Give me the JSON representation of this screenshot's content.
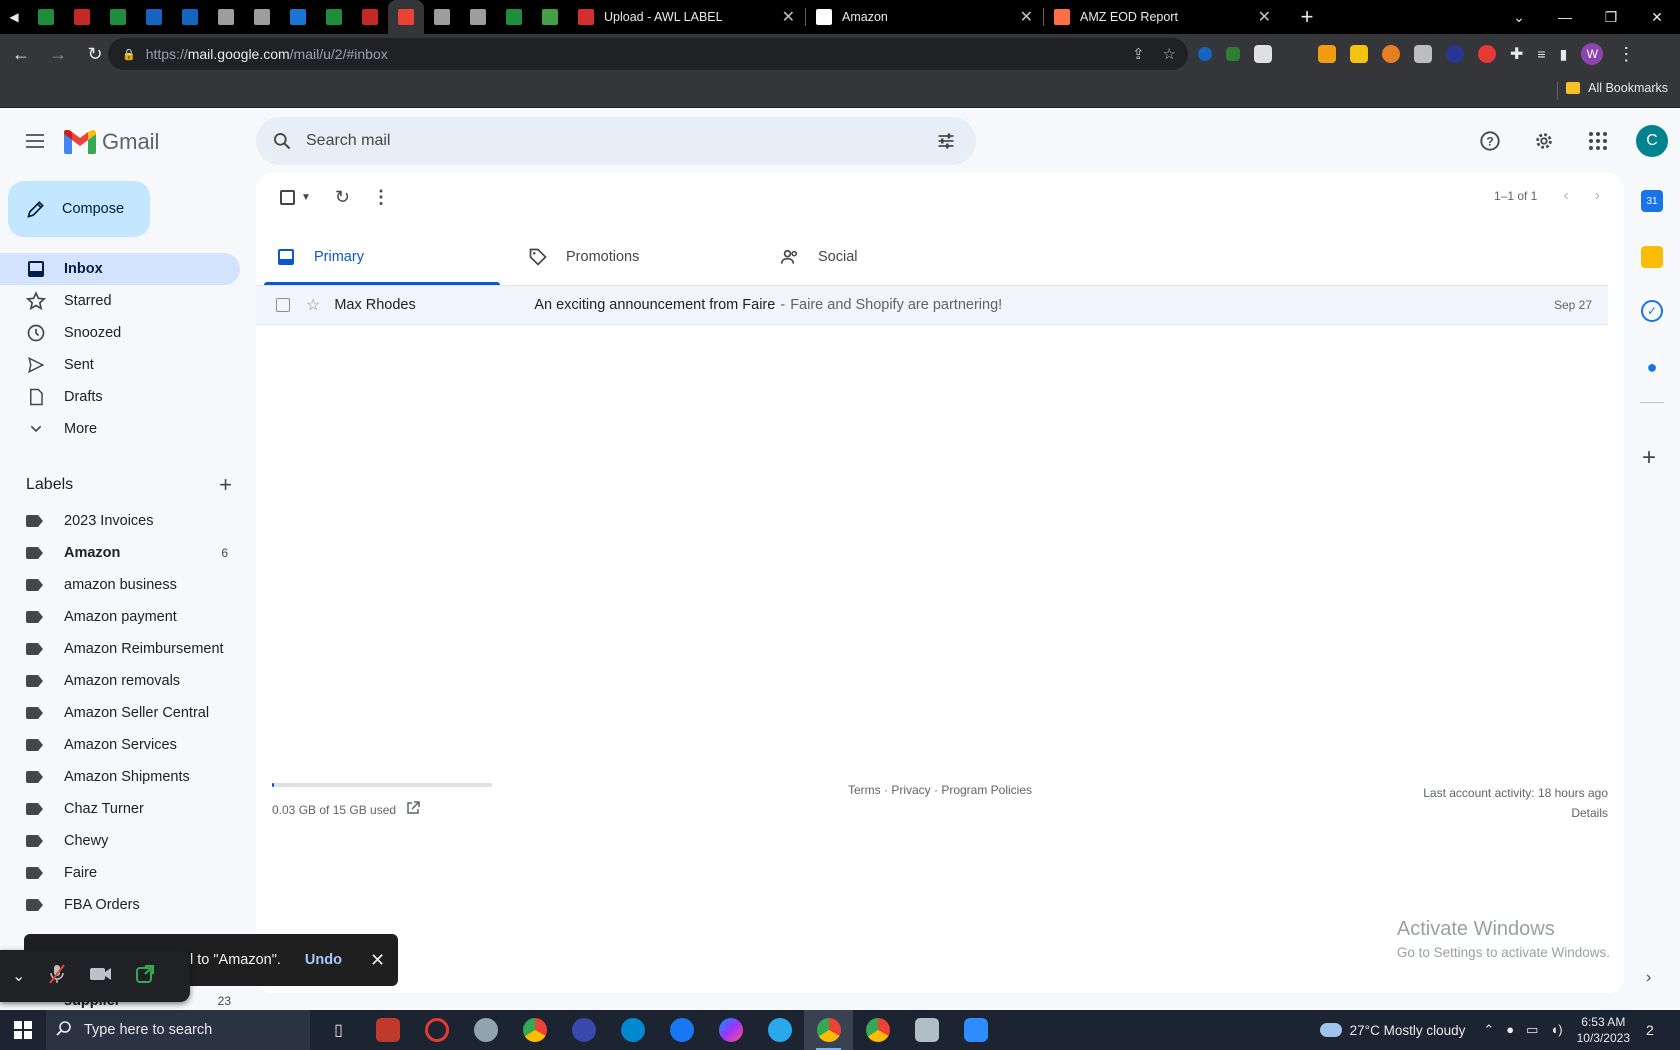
{
  "browser": {
    "pinned_tabs": [
      {
        "icon": "sheets-icon",
        "color": "#1e8e3e"
      },
      {
        "icon": "word-red-icon",
        "color": "#c62828"
      },
      {
        "icon": "sheets-icon",
        "color": "#1e8e3e"
      },
      {
        "icon": "app-blue-icon",
        "color": "#1565c0"
      },
      {
        "icon": "app-blue-icon",
        "color": "#1565c0"
      },
      {
        "icon": "page-icon",
        "color": "#9e9e9e"
      },
      {
        "icon": "page-icon",
        "color": "#9e9e9e"
      },
      {
        "icon": "gear-blue-icon",
        "color": "#1976d2"
      },
      {
        "icon": "sheets-icon",
        "color": "#1e8e3e"
      },
      {
        "icon": "word-red-icon",
        "color": "#c62828"
      },
      {
        "icon": "gmail-icon",
        "color": "#ea4335"
      },
      {
        "icon": "page-icon",
        "color": "#9e9e9e"
      },
      {
        "icon": "page-icon",
        "color": "#9e9e9e"
      },
      {
        "icon": "sheets-icon",
        "color": "#1e8e3e"
      },
      {
        "icon": "notes-green-icon",
        "color": "#43a047"
      }
    ],
    "tabs": [
      {
        "title": "Upload - AWL LABEL",
        "icon": "awl-icon",
        "color": "#d32f2f"
      },
      {
        "title": "Amazon",
        "icon": "amazon-icon",
        "color": "#ffffff"
      },
      {
        "title": "AMZ EOD Report",
        "icon": "report-icon",
        "color": "#ff7043"
      }
    ],
    "new_tab": "+",
    "url_prefix": "https://",
    "url_host": "mail.google.com",
    "url_path": "/mail/u/2/#inbox",
    "bookmarks_label": "All Bookmarks",
    "profile_initial": "W"
  },
  "gmail": {
    "app_name": "Gmail",
    "search_placeholder": "Search mail",
    "avatar_initial": "C",
    "compose_label": "Compose",
    "nav": [
      {
        "label": "Inbox",
        "icon": "inbox-icon",
        "active": true
      },
      {
        "label": "Starred",
        "icon": "star-icon"
      },
      {
        "label": "Snoozed",
        "icon": "clock-icon"
      },
      {
        "label": "Sent",
        "icon": "send-icon"
      },
      {
        "label": "Drafts",
        "icon": "draft-icon"
      },
      {
        "label": "More",
        "icon": "chevron-down-icon"
      }
    ],
    "labels_heading": "Labels",
    "labels": [
      {
        "name": "2023 Invoices"
      },
      {
        "name": "Amazon",
        "count": "6",
        "bold": true
      },
      {
        "name": "amazon business"
      },
      {
        "name": "Amazon payment"
      },
      {
        "name": "Amazon Reimbursement"
      },
      {
        "name": "Amazon removals"
      },
      {
        "name": "Amazon Seller Central"
      },
      {
        "name": "Amazon Services"
      },
      {
        "name": "Amazon Shipments"
      },
      {
        "name": "Chaz Turner"
      },
      {
        "name": "Chewy"
      },
      {
        "name": "Faire"
      },
      {
        "name": "FBA Orders"
      }
    ],
    "partial_label": {
      "name": "supplier",
      "count": "23"
    },
    "pager": "1–1 of 1",
    "tabs": [
      {
        "label": "Primary",
        "icon": "inbox-tab-icon",
        "active": true
      },
      {
        "label": "Promotions",
        "icon": "tag-icon"
      },
      {
        "label": "Social",
        "icon": "people-icon"
      }
    ],
    "mails": [
      {
        "sender": "Max Rhodes",
        "subject": "An exciting announcement from Faire",
        "snippet": "Faire and Shopify are partnering!",
        "date": "Sep 27"
      }
    ],
    "storage_used_fraction": 0.002,
    "storage_text": "0.03 GB of 15 GB used",
    "footer_links": [
      "Terms",
      "Privacy",
      "Program Policies"
    ],
    "last_activity": "Last account activity: 18 hours ago",
    "details_link": "Details",
    "snackbar_text": "l to \"Amazon\".",
    "snackbar_undo": "Undo"
  },
  "windows": {
    "watermark_title": "Activate Windows",
    "watermark_sub": "Go to Settings to activate Windows.",
    "search_placeholder": "Type here to search",
    "weather": "27°C  Mostly cloudy",
    "time": "6:53 AM",
    "date": "10/3/2023",
    "notification_count": "2"
  },
  "colors": {
    "accent": "#0b57d0",
    "compose_bg": "#c2e7ff",
    "inbox_active_bg": "#d3e3fd"
  }
}
